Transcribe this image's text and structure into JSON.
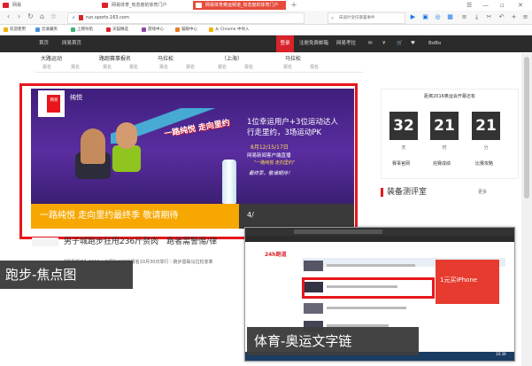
{
  "browser": {
    "tabs": [
      {
        "label": "网易"
      },
      {
        "label": "网易体育_有态度的体育门户"
      },
      {
        "label": "网易体育奥运频道_有态度的体育门户",
        "active": true
      }
    ],
    "new_tab": "+",
    "window_controls": [
      "☰",
      "—",
      "▫",
      "✕"
    ],
    "url": "run.sports.163.com",
    "search_placeholder": "朱丽叶受伤暴露事件",
    "bookmarks": [
      "欢迎使用",
      "云收藏夹",
      "上网导航",
      "天猫精选",
      "游戏中心",
      "猫眼中心",
      "从 Chrome 中导入"
    ]
  },
  "site_nav": {
    "left": [
      "首页",
      "网易首页"
    ],
    "login": "登录",
    "items": [
      "注册免费邮箱",
      "网易考拉",
      "✉",
      "¥",
      "🛒",
      "♥",
      "BoBo"
    ]
  },
  "categories": [
    {
      "title": "大路运动",
      "links": [
        "报名",
        "报名"
      ]
    },
    {
      "title": "路跑赛事报名",
      "links": [
        "报名",
        "报名"
      ]
    },
    {
      "title": "马拉松",
      "links": [
        "报名",
        "报名"
      ]
    },
    {
      "title": "（上海）",
      "links": [
        "报名",
        "报名"
      ]
    },
    {
      "title": "马拉松",
      "links": [
        "报名",
        "报名"
      ]
    }
  ],
  "banner": {
    "logo": "网易",
    "brand": "纯悦",
    "slogan": "一路纯悦 走向里约",
    "main_line1": "1位幸运用户+3位运动达人",
    "main_line2": "行走里约，3场运动PK",
    "date": "8月12/15/17日",
    "org": "网易新闻客户端直播",
    "tag": "\"一路纯悦 走向里约\"",
    "prize": "最终季，敬请期待！",
    "caption": "一路纯悦 走向里约最终季 敬请期待",
    "page_num": "4/"
  },
  "labels": {
    "focus": "跑步-焦点图",
    "olympic": "体育-奥运文字链"
  },
  "article": {
    "headline": "男子城跑步狂甩236斤赘肉　跑者需警惕/律",
    "abstract": "【赛事报名】2016上海国际马拉松报名10月30日举行｜跑步基础马拉松变革"
  },
  "countdown": {
    "title": "距离2016奥运会开幕还有",
    "days": "32",
    "hours": "21",
    "minutes": "21",
    "units": [
      "天",
      "时",
      "分"
    ],
    "links": [
      "赛事官网",
      "完赛成绩",
      "比赛攻略"
    ]
  },
  "review": {
    "title": "装备测评室",
    "more": "更多"
  },
  "inset": {
    "logo": "24h跑道",
    "ad": "1元买iPhone",
    "clock": "10:39"
  }
}
